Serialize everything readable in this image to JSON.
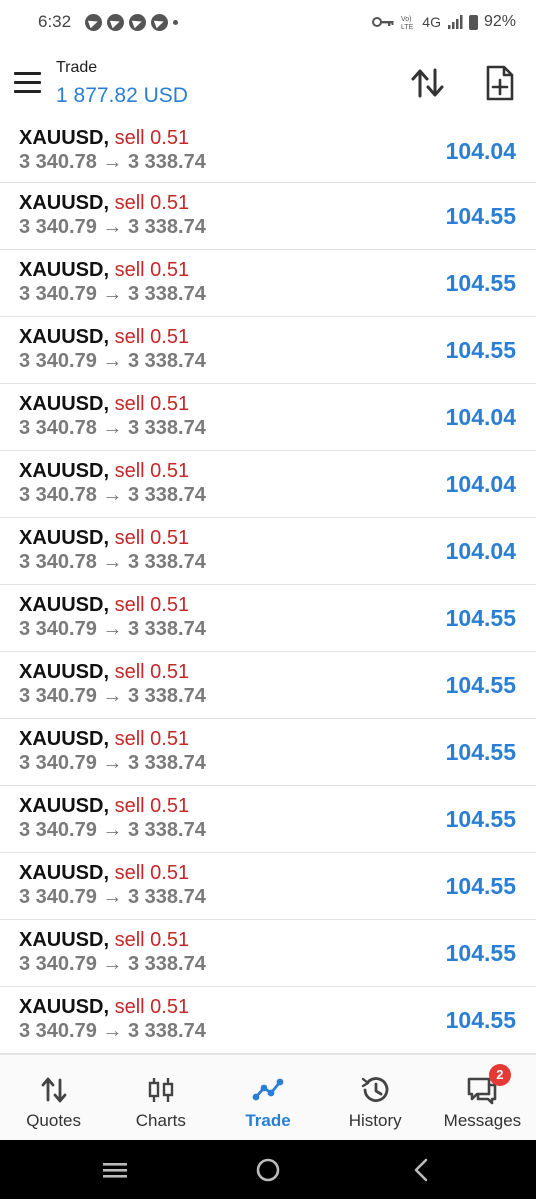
{
  "status_bar": {
    "time": "6:32",
    "network_text": "4G",
    "battery": "92%"
  },
  "header": {
    "title": "Trade",
    "balance": "1 877.82 USD",
    "icons": [
      "menu-icon",
      "sort-icon",
      "new-order-icon"
    ]
  },
  "trades": [
    {
      "symbol": "XAUUSD,",
      "side": "sell 0.51",
      "prices": "3 340.78 → 3 338.74",
      "profit": "104.04"
    },
    {
      "symbol": "XAUUSD,",
      "side": "sell 0.51",
      "prices": "3 340.79 → 3 338.74",
      "profit": "104.55"
    },
    {
      "symbol": "XAUUSD,",
      "side": "sell 0.51",
      "prices": "3 340.79 → 3 338.74",
      "profit": "104.55"
    },
    {
      "symbol": "XAUUSD,",
      "side": "sell 0.51",
      "prices": "3 340.79 → 3 338.74",
      "profit": "104.55"
    },
    {
      "symbol": "XAUUSD,",
      "side": "sell 0.51",
      "prices": "3 340.78 → 3 338.74",
      "profit": "104.04"
    },
    {
      "symbol": "XAUUSD,",
      "side": "sell 0.51",
      "prices": "3 340.78 → 3 338.74",
      "profit": "104.04"
    },
    {
      "symbol": "XAUUSD,",
      "side": "sell 0.51",
      "prices": "3 340.78 → 3 338.74",
      "profit": "104.04"
    },
    {
      "symbol": "XAUUSD,",
      "side": "sell 0.51",
      "prices": "3 340.79 → 3 338.74",
      "profit": "104.55"
    },
    {
      "symbol": "XAUUSD,",
      "side": "sell 0.51",
      "prices": "3 340.79 → 3 338.74",
      "profit": "104.55"
    },
    {
      "symbol": "XAUUSD,",
      "side": "sell 0.51",
      "prices": "3 340.79 → 3 338.74",
      "profit": "104.55"
    },
    {
      "symbol": "XAUUSD,",
      "side": "sell 0.51",
      "prices": "3 340.79 → 3 338.74",
      "profit": "104.55"
    },
    {
      "symbol": "XAUUSD,",
      "side": "sell 0.51",
      "prices": "3 340.79 → 3 338.74",
      "profit": "104.55"
    },
    {
      "symbol": "XAUUSD,",
      "side": "sell 0.51",
      "prices": "3 340.79 → 3 338.74",
      "profit": "104.55"
    },
    {
      "symbol": "XAUUSD,",
      "side": "sell 0.51",
      "prices": "3 340.79 → 3 338.74",
      "profit": "104.55"
    }
  ],
  "nav": {
    "items": [
      {
        "label": "Quotes",
        "icon": "quotes-icon"
      },
      {
        "label": "Charts",
        "icon": "charts-icon"
      },
      {
        "label": "Trade",
        "icon": "trade-icon",
        "active": true
      },
      {
        "label": "History",
        "icon": "history-icon"
      },
      {
        "label": "Messages",
        "icon": "messages-icon",
        "badge": "2"
      }
    ]
  },
  "system_nav": {
    "icons": [
      "recent-apps-icon",
      "home-icon",
      "back-icon"
    ]
  },
  "colors": {
    "accent": "#2a7fd4",
    "sell": "#c62828",
    "badge": "#e53935"
  }
}
